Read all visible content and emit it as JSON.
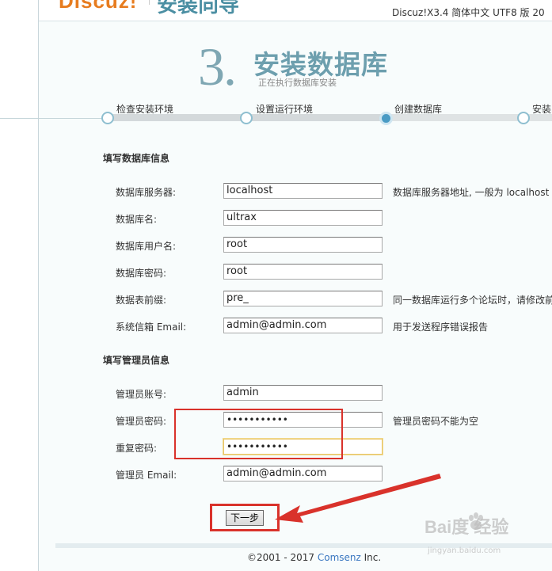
{
  "header": {
    "logo": "Discuz!",
    "logo_sub": "安装向导",
    "version": "Discuz!X3.4 简体中文 UTF8 版 20"
  },
  "step": {
    "number": "3.",
    "title": "安装数据库",
    "description": "正在执行数据库安装"
  },
  "progress": {
    "steps": [
      {
        "label": "检查安装环境"
      },
      {
        "label": "设置运行环境"
      },
      {
        "label": "创建数据库"
      },
      {
        "label": "安装"
      }
    ],
    "current_step": 3
  },
  "db_section": {
    "title": "填写数据库信息",
    "fields": [
      {
        "label": "数据库服务器:",
        "value": "localhost",
        "hint": "数据库服务器地址, 一般为 localhost"
      },
      {
        "label": "数据库名:",
        "value": "ultrax",
        "hint": ""
      },
      {
        "label": "数据库用户名:",
        "value": "root",
        "hint": ""
      },
      {
        "label": "数据库密码:",
        "value": "root",
        "hint": ""
      },
      {
        "label": "数据表前缀:",
        "value": "pre_",
        "hint": "同一数据库运行多个论坛时，请修改前"
      },
      {
        "label": "系统信箱 Email:",
        "value": "admin@admin.com",
        "hint": "用于发送程序错误报告"
      }
    ]
  },
  "admin_section": {
    "title": "填写管理员信息",
    "fields": [
      {
        "label": "管理员账号:",
        "value": "admin",
        "hint": ""
      },
      {
        "label": "管理员密码:",
        "value": "•••••••••••",
        "hint": "管理员密码不能为空"
      },
      {
        "label": "重复密码:",
        "value": "•••••••••••",
        "hint": ""
      },
      {
        "label": "管理员 Email:",
        "value": "admin@admin.com",
        "hint": ""
      }
    ]
  },
  "actions": {
    "next_label": "下一步"
  },
  "footer": {
    "copyright": "©2001 - 2017 ",
    "brand": "Comsenz",
    "suffix": " Inc."
  },
  "watermark": {
    "text": "Bai度 经验",
    "sub": "jingyan.baidu.com"
  },
  "colors": {
    "annotation": "#d9322b",
    "accent": "#6d9fae",
    "logo": "#e77c1f"
  }
}
